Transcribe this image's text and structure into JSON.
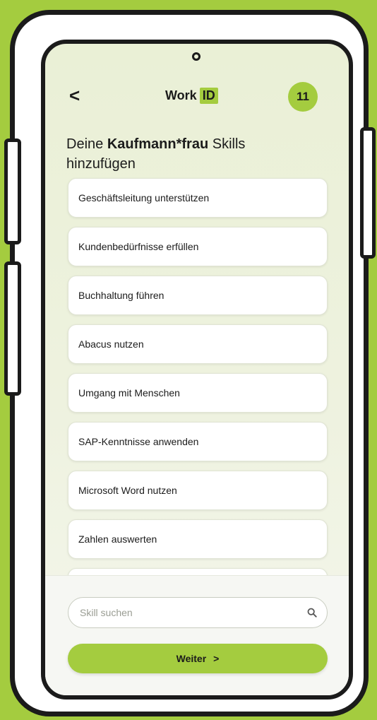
{
  "header": {
    "back_glyph": "<",
    "logo_work": "Work",
    "logo_id": "ID",
    "count": "11"
  },
  "title": {
    "prefix": "Deine ",
    "bold": "Kaufmann*frau",
    "suffix": " Skills hinzufügen"
  },
  "skills": [
    "Geschäftsleitung unterstützen",
    "Kundenbedürfnisse erfüllen",
    "Buchhaltung führen",
    "Abacus nutzen",
    "Umgang mit Menschen",
    "SAP-Kenntnisse anwenden",
    "Microsoft Word nutzen",
    "Zahlen auswerten"
  ],
  "search": {
    "placeholder": "Skill suchen",
    "icon": "search-icon"
  },
  "continue": {
    "label": "Weiter",
    "glyph": ">"
  },
  "colors": {
    "accent": "#a4cc3f",
    "screen_bg": "#eef2df",
    "frame": "#1b1b1b"
  }
}
